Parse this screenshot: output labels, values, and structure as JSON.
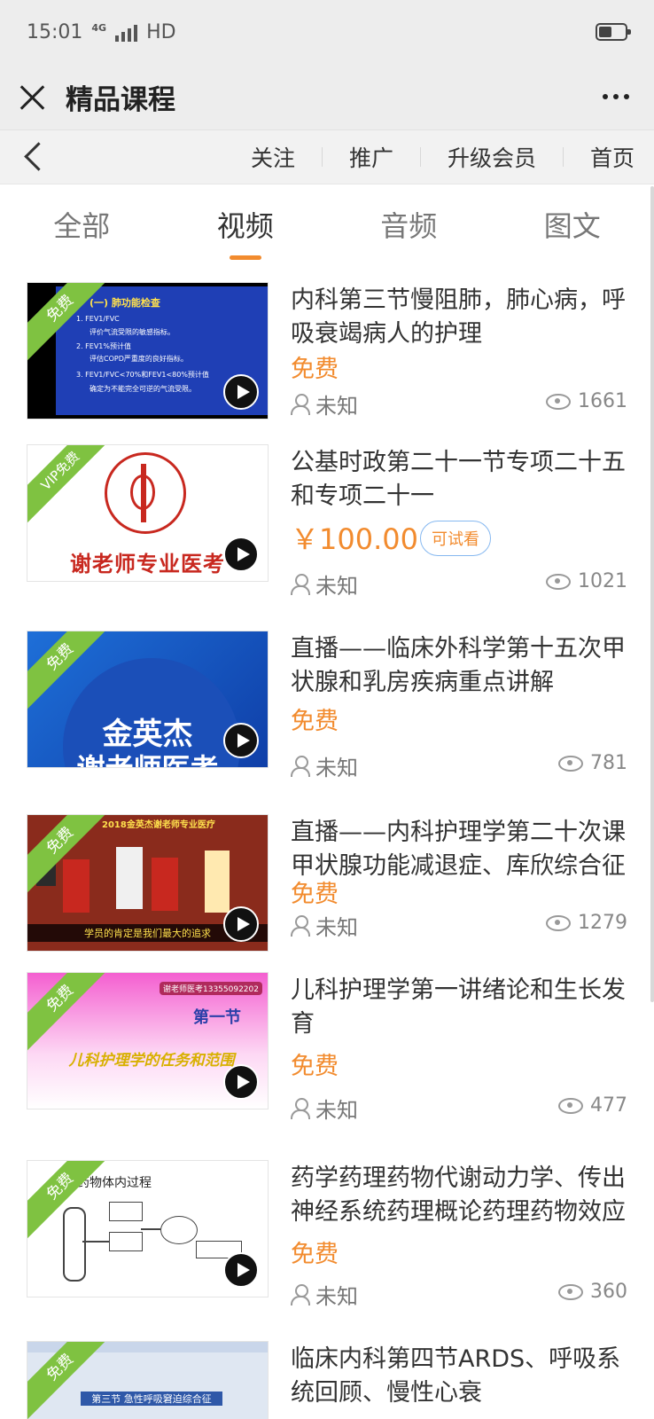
{
  "status": {
    "time": "15:01",
    "network": "4G",
    "hd": "HD"
  },
  "header": {
    "title": "精品课程"
  },
  "nav": {
    "follow": "关注",
    "promote": "推广",
    "upgrade": "升级会员",
    "home": "首页"
  },
  "tabs": [
    "全部",
    "视频",
    "音频",
    "图文"
  ],
  "active_tab": "视频",
  "accent_color": "#f28b2e",
  "ribbon_color": "#7fc241",
  "courses": [
    {
      "title": "内科第三节慢阻肺，肺心病，呼吸衰竭病人的护理",
      "price": "免费",
      "author": "未知",
      "views": "1661",
      "ribbon": "免费",
      "thumb_heading": "(一) 肺功能检查",
      "thumb_lines": [
        "1. FEV1/FVC",
        "评价气流受限的敏感指标。",
        "2. FEV1%预计值",
        "评估COPD严重度的良好指标。",
        "3. FEV1/FVC<70%和FEV1<80%预计值",
        "确定为不能完全可逆的气流受限。"
      ]
    },
    {
      "title": "公基时政第二十一节专项二十五和专项二十一",
      "price": "￥100.00",
      "trial": "可试看",
      "author": "未知",
      "views": "1021",
      "ribbon": "VIP免费",
      "thumb_text": "谢老师专业医考"
    },
    {
      "title": "直播——临床外科学第十五次甲状腺和乳房疾病重点讲解",
      "price": "免费",
      "author": "未知",
      "views": "781",
      "ribbon": "免费",
      "thumb_line1": "金英杰",
      "thumb_line2": "谢老师医考"
    },
    {
      "title": "直播——内科护理学第二十次课甲状腺功能减退症、库欣综合征",
      "price": "免费",
      "author": "未知",
      "views": "1279",
      "ribbon": "免费",
      "thumb_caption": "学员的肯定是我们最大的追求",
      "thumb_top": "2018金英杰谢老师专业医疗"
    },
    {
      "title": "儿科护理学第一讲绪论和生长发育",
      "price": "免费",
      "author": "未知",
      "views": "477",
      "ribbon": "免费",
      "thumb_phone": "谢老师医考13355092202",
      "thumb_section": "第一节",
      "thumb_text": "儿科护理学的任务和范围"
    },
    {
      "title": "药学药理药物代谢动力学、传出神经系统药理概论药理药物效应动力学",
      "price": "免费",
      "author": "未知",
      "views": "360",
      "ribbon": "免费",
      "thumb_text": "药物体内过程"
    },
    {
      "title": "临床内科第四节ARDS、呼吸系统回顾、慢性心衰",
      "ribbon": "免费",
      "thumb_text": "第三节 急性呼吸窘迫综合征"
    }
  ]
}
